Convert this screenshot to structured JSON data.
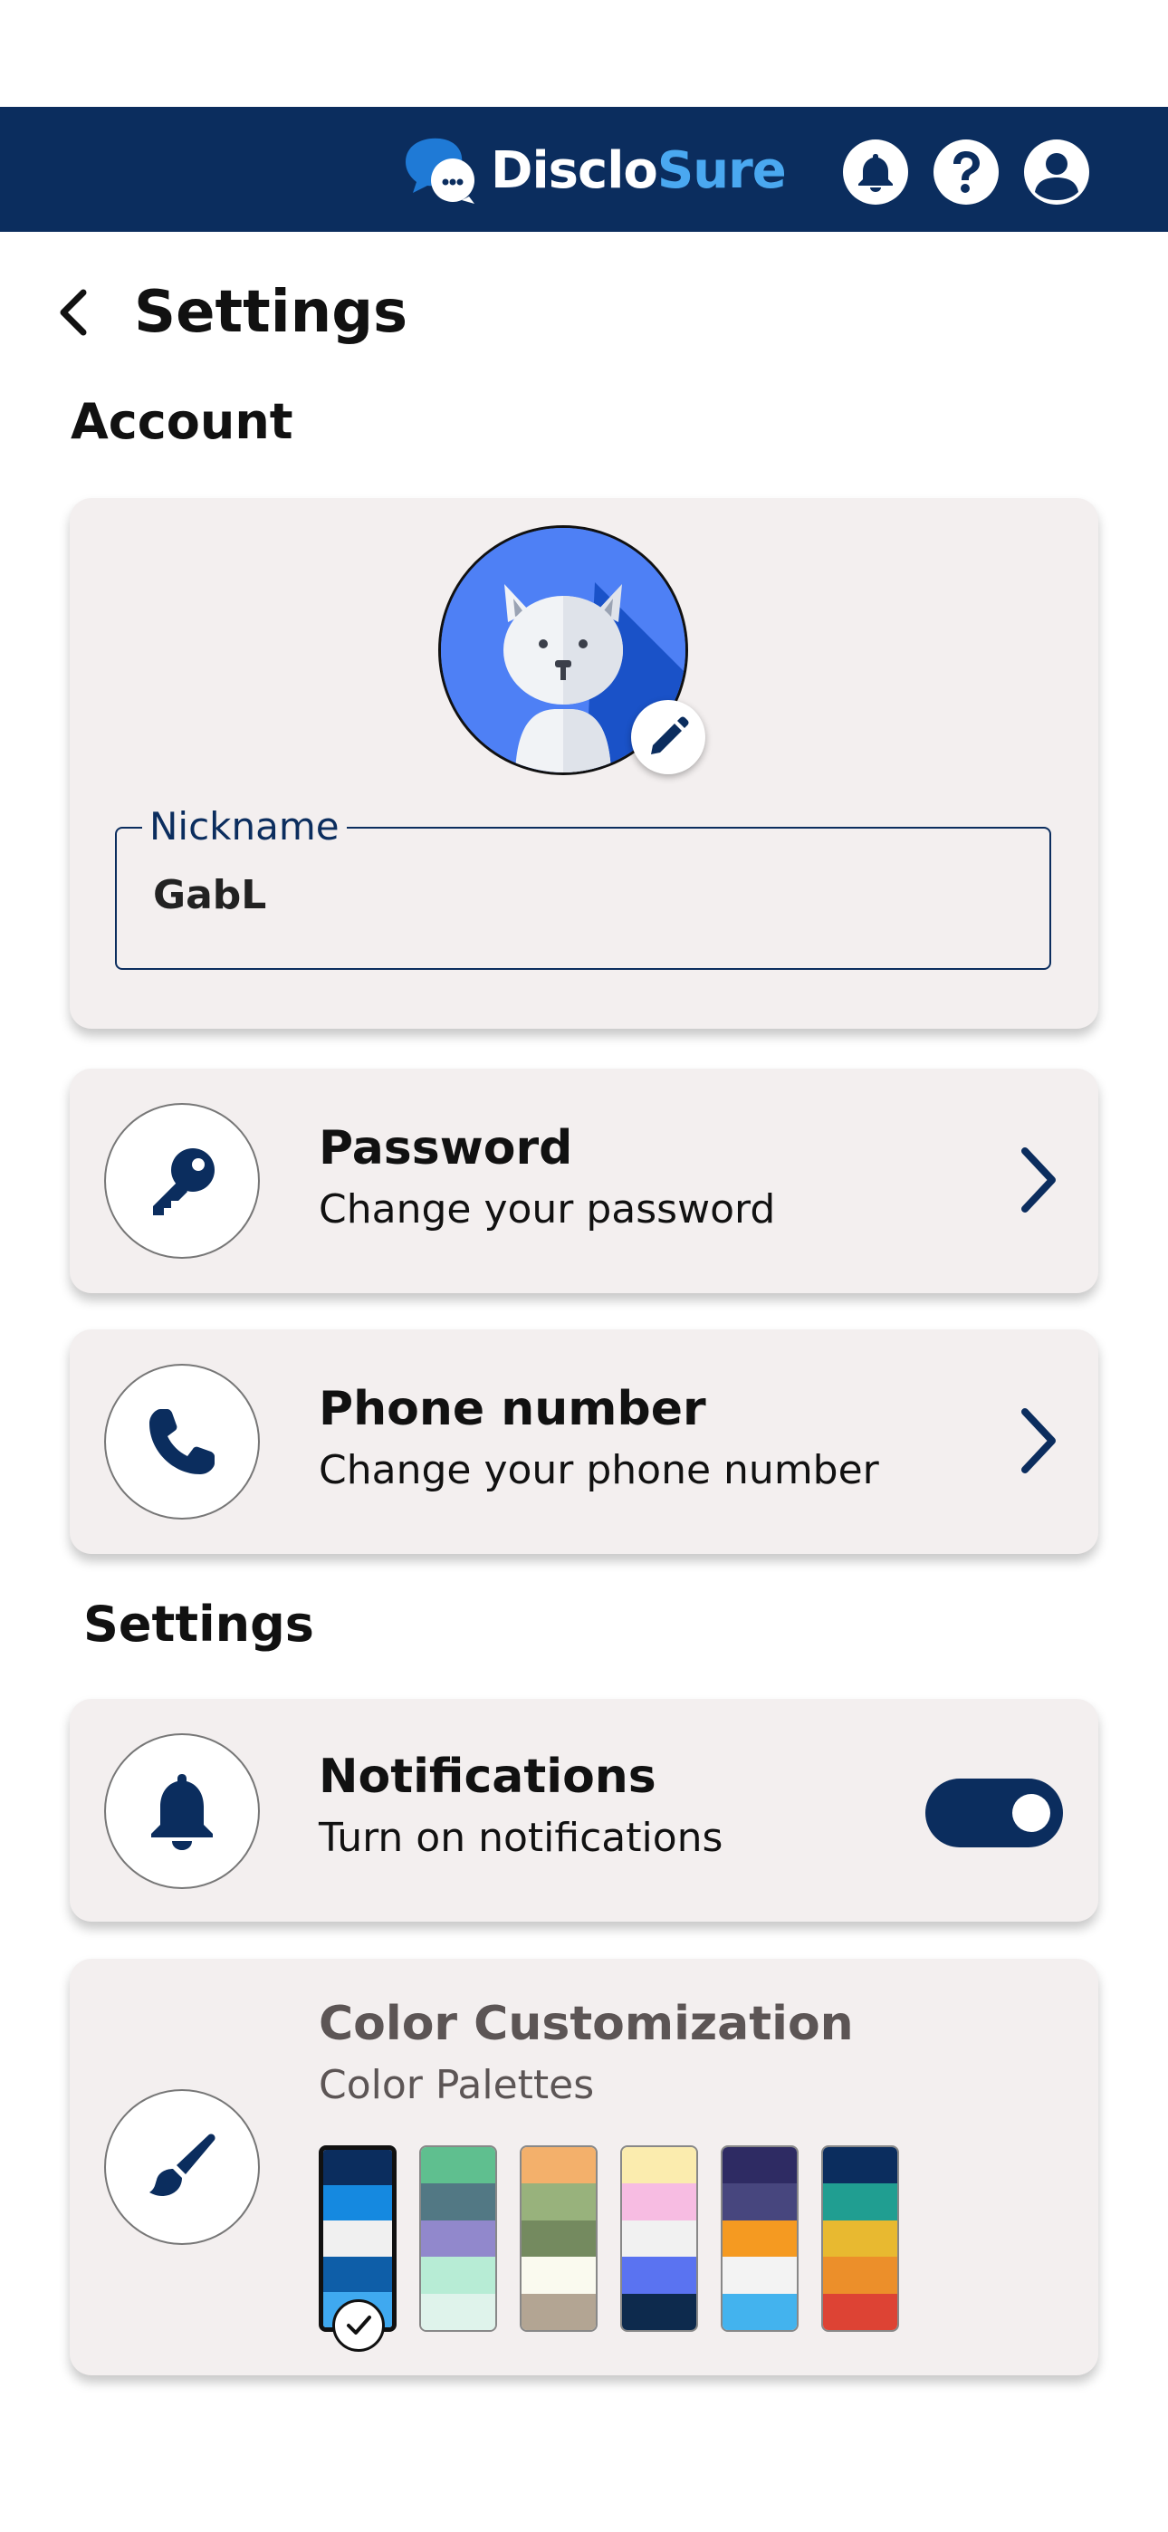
{
  "header": {
    "logo_part1": "Disclo",
    "logo_part2": "Sure",
    "icons": [
      "bell-icon",
      "help-icon",
      "account-icon"
    ],
    "colors": {
      "bar": "#0b2d5e",
      "logo_light": "#4aa8f0"
    }
  },
  "page": {
    "title": "Settings"
  },
  "account": {
    "section_label": "Account",
    "avatar_icon": "cat-avatar",
    "nickname": {
      "label": "Nickname",
      "value": "GabL"
    }
  },
  "password": {
    "title": "Password",
    "subtitle": "Change your password",
    "icon": "key-icon"
  },
  "phone": {
    "title": "Phone number",
    "subtitle": "Change your phone number",
    "icon": "phone-icon"
  },
  "settings": {
    "section_label": "Settings"
  },
  "notifications": {
    "title": "Notifications",
    "subtitle": "Turn on notifications",
    "icon": "bell-icon",
    "enabled": true
  },
  "color_customization": {
    "title": "Color Customization",
    "subtitle": "Color Palettes",
    "icon": "brush-icon",
    "selected_index": 0,
    "palettes": [
      [
        "#0b2d5e",
        "#1589e0",
        "#f0f0f0",
        "#0e5ea8",
        "#3fa9f0"
      ],
      [
        "#5fbf8f",
        "#527884",
        "#9188cc",
        "#b7ecd5",
        "#dff3eb"
      ],
      [
        "#f3b06b",
        "#98b27c",
        "#748a5f",
        "#fafaef",
        "#b3a593"
      ],
      [
        "#fbecae",
        "#f7bce2",
        "#f1f1f1",
        "#5a73f1",
        "#0d2a4d"
      ],
      [
        "#2e2b63",
        "#47467e",
        "#f59a21",
        "#f3f3f3",
        "#43b3ee"
      ],
      [
        "#0b2d5e",
        "#209e91",
        "#e8b930",
        "#ec8f2a",
        "#dd4334"
      ]
    ]
  }
}
